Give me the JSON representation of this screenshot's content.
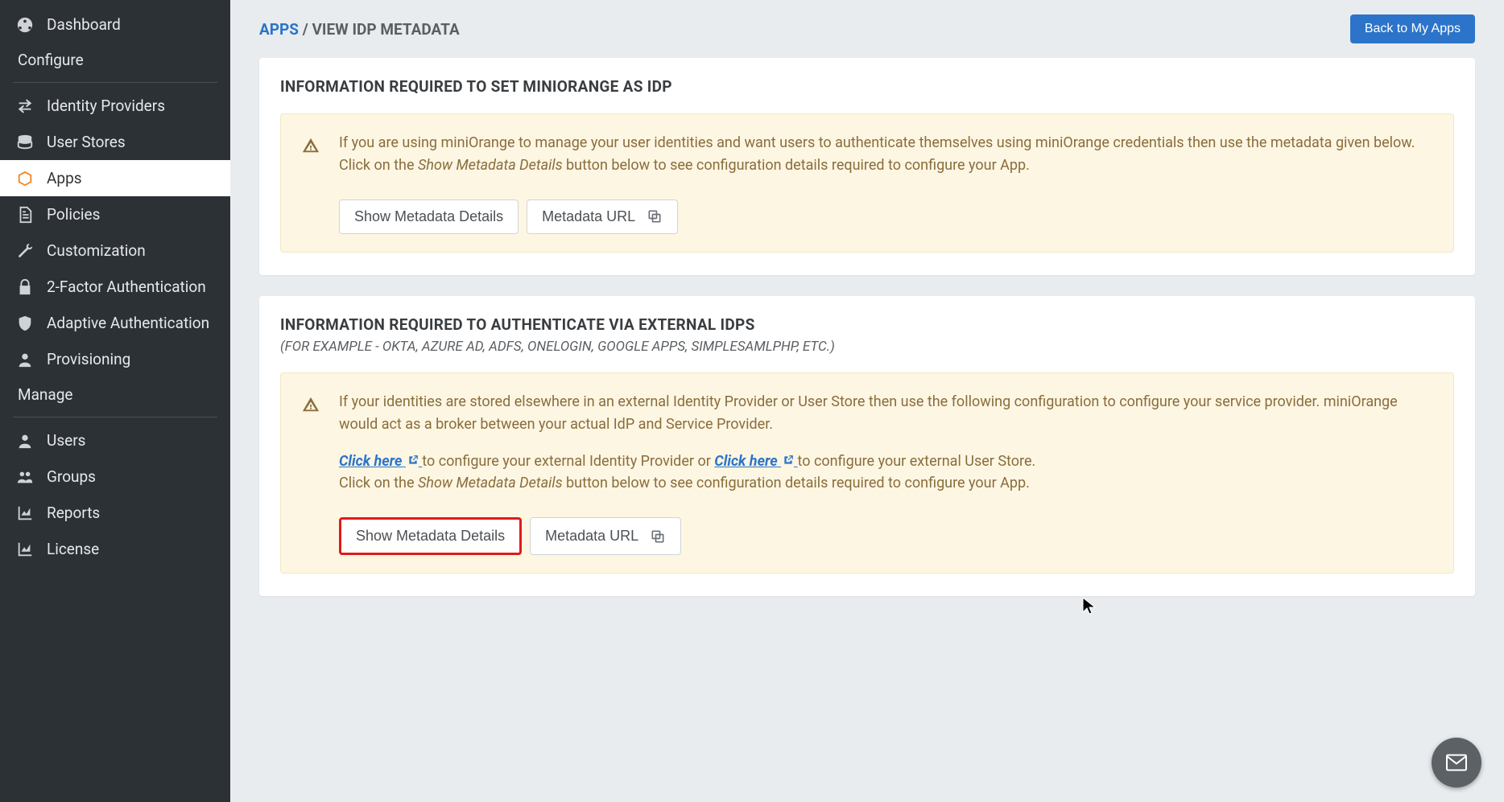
{
  "sidebar": {
    "items": [
      {
        "label": "Dashboard"
      },
      {
        "label": "Identity Providers"
      },
      {
        "label": "User Stores"
      },
      {
        "label": "Apps"
      },
      {
        "label": "Policies"
      },
      {
        "label": "Customization"
      },
      {
        "label": "2-Factor Authentication"
      },
      {
        "label": "Adaptive Authentication"
      },
      {
        "label": "Provisioning"
      },
      {
        "label": "Users"
      },
      {
        "label": "Groups"
      },
      {
        "label": "Reports"
      },
      {
        "label": "License"
      }
    ],
    "sections": {
      "configure": "Configure",
      "manage": "Manage"
    }
  },
  "breadcrumb": {
    "root": "APPS",
    "sep": " / ",
    "current": "VIEW IDP METADATA"
  },
  "actions": {
    "back": "Back to My Apps"
  },
  "card1": {
    "title": "INFORMATION REQUIRED TO SET MINIORANGE AS IDP",
    "para1": "If you are using miniOrange to manage your user identities and want users to authenticate themselves using miniOrange credentials then use the metadata given below.",
    "para2_a": "Click on the ",
    "para2_b": "Show Metadata Details",
    "para2_c": " button below to see configuration details required to configure your App.",
    "btn_show": "Show Metadata Details",
    "btn_url": "Metadata URL"
  },
  "card2": {
    "title": "INFORMATION REQUIRED TO AUTHENTICATE VIA EXTERNAL IDPS",
    "subtitle": "(FOR EXAMPLE - OKTA, AZURE AD, ADFS, ONELOGIN, GOOGLE APPS, SIMPLESAMLPHP, ETC.)",
    "para1": "If your identities are stored elsewhere in an external Identity Provider or User Store then use the following configuration to configure your service provider. miniOrange would act as a broker between your actual IdP and Service Provider.",
    "link1": "Click here",
    "mid1": " to configure your external Identity Provider or ",
    "link2": "Click here",
    "mid2": " to configure your external User Store.",
    "para2_a": "Click on the ",
    "para2_b": "Show Metadata Details",
    "para2_c": " button below to see configuration details required to configure your App.",
    "btn_show": "Show Metadata Details",
    "btn_url": "Metadata URL"
  }
}
